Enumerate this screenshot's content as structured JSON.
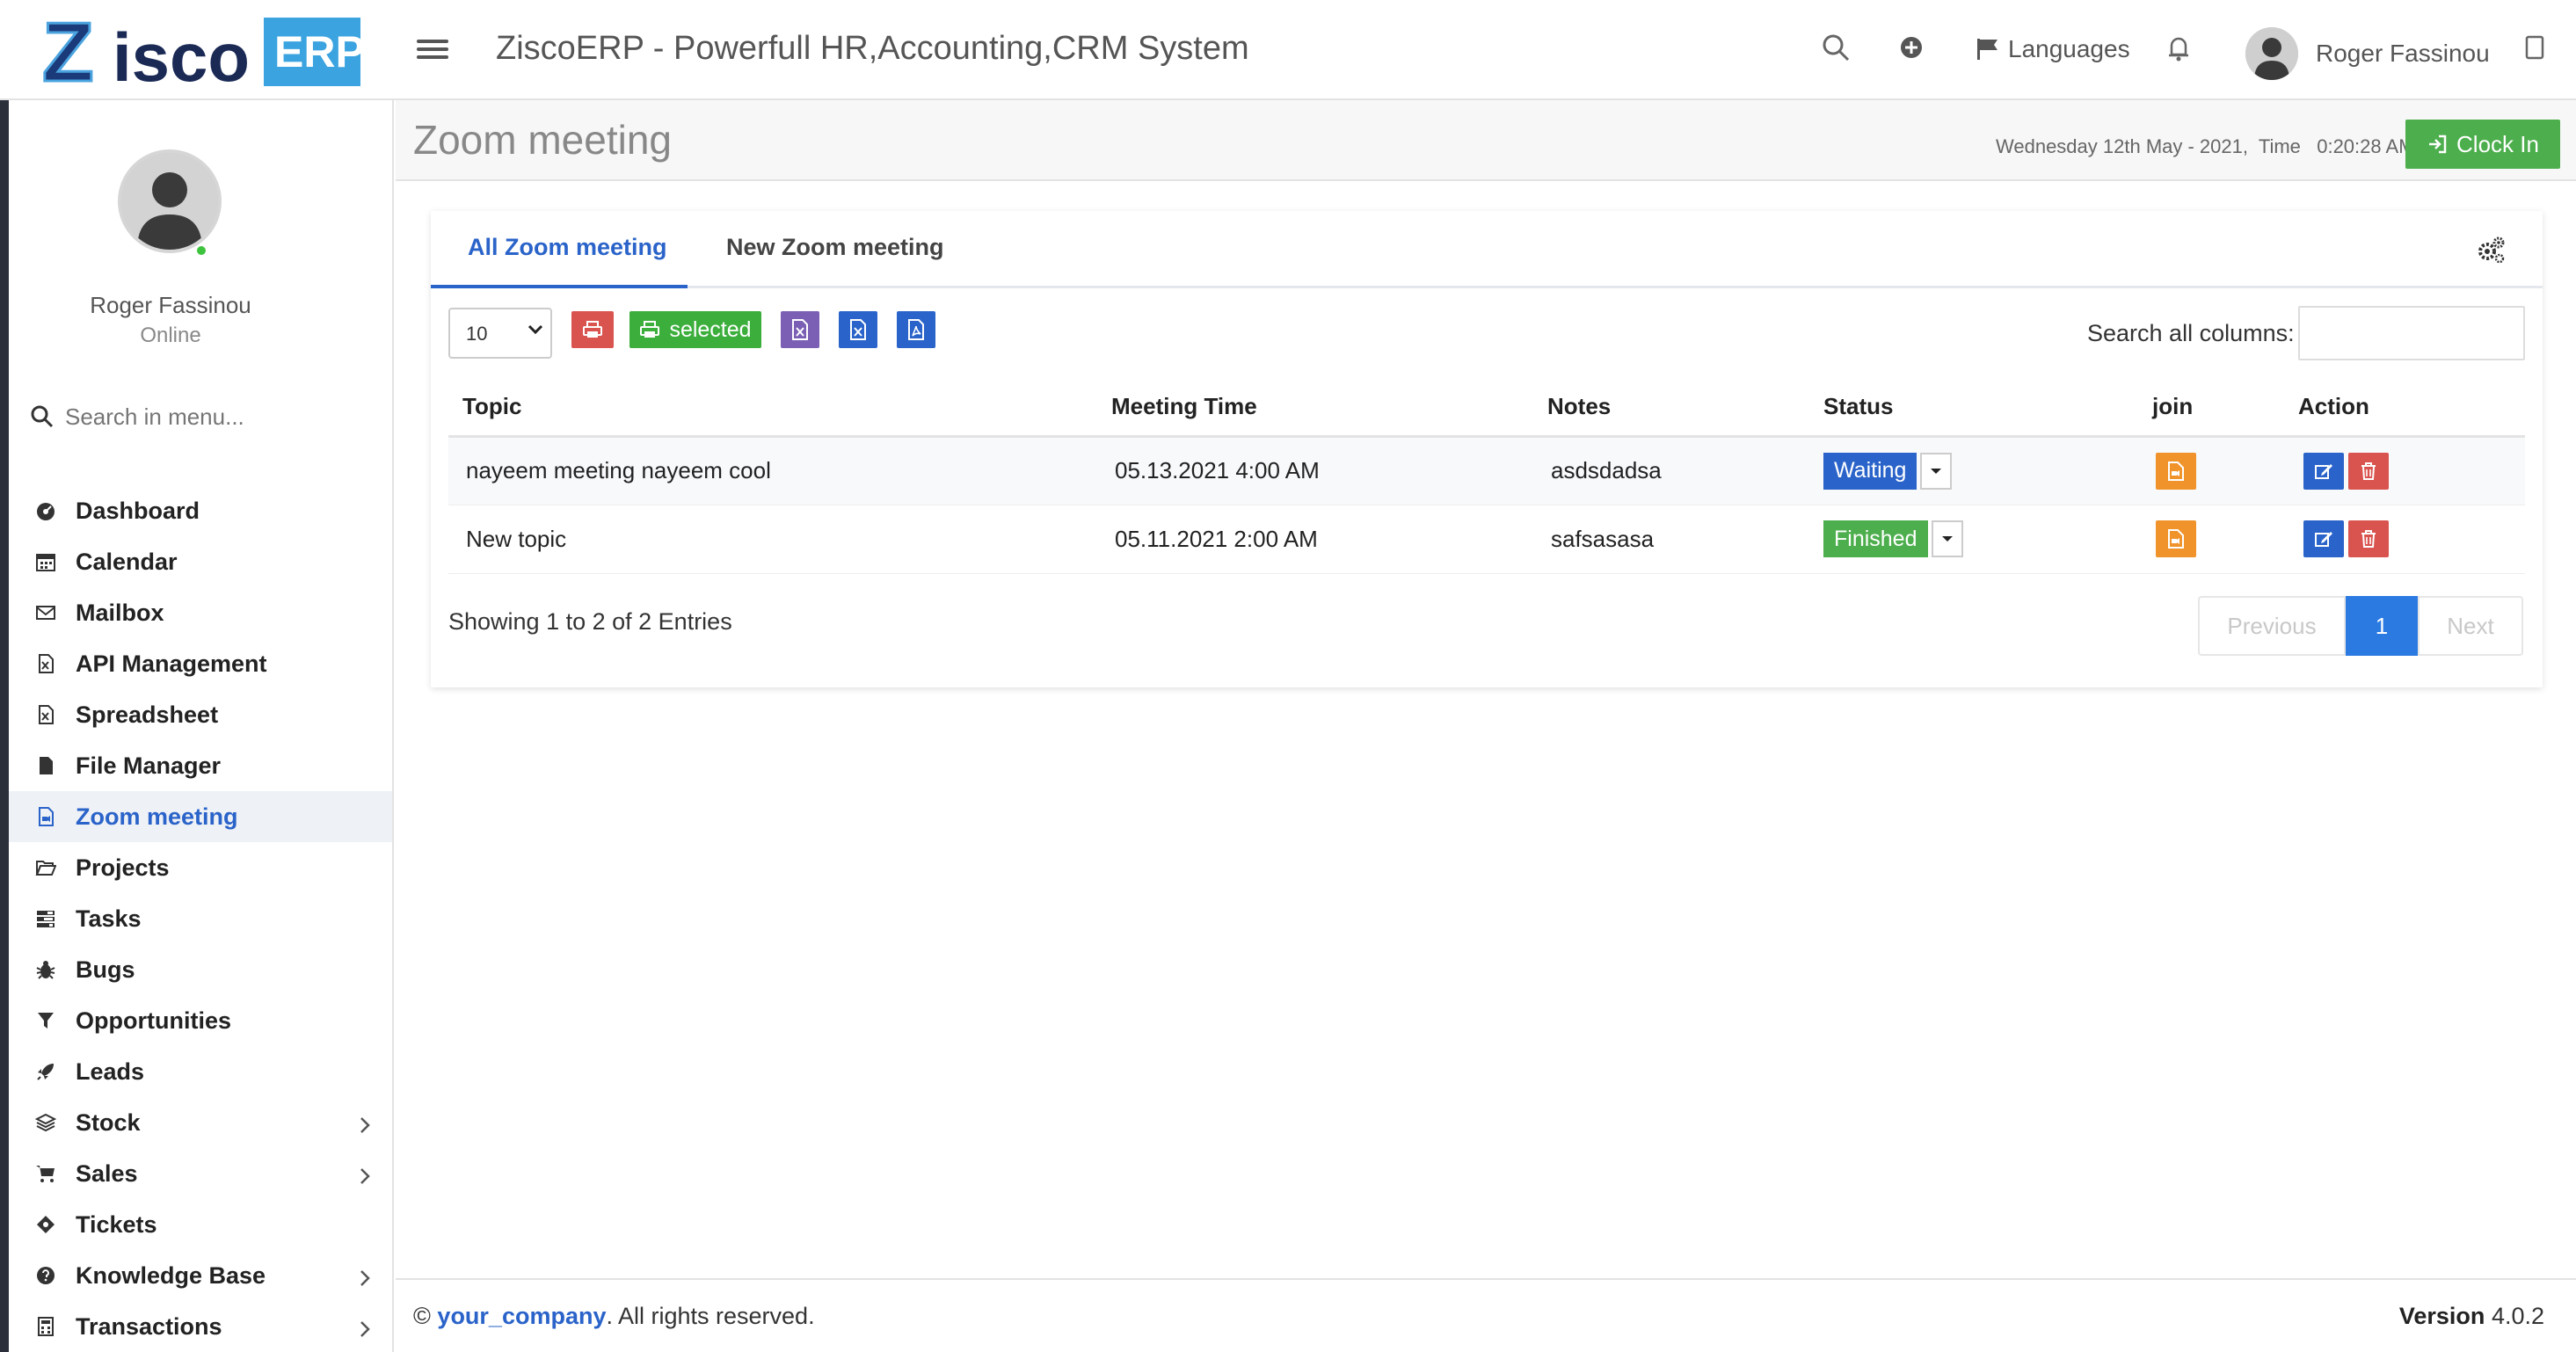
{
  "brand": {
    "logo_text": "Zisco",
    "logo_badge": "ERP"
  },
  "header": {
    "app_title": "ZiscoERP - Powerfull HR,Accounting,CRM System",
    "languages_label": "Languages",
    "user_name": "Roger Fassinou"
  },
  "sidebar": {
    "profile_name": "Roger Fassinou",
    "profile_status": "Online",
    "search_placeholder": "Search in menu...",
    "items": [
      {
        "label": "Dashboard",
        "icon": "dashboard-icon",
        "has_submenu": false
      },
      {
        "label": "Calendar",
        "icon": "calendar-icon",
        "has_submenu": false
      },
      {
        "label": "Mailbox",
        "icon": "envelope-icon",
        "has_submenu": false
      },
      {
        "label": "API Management",
        "icon": "excel-file-icon",
        "has_submenu": false
      },
      {
        "label": "Spreadsheet",
        "icon": "excel-file-icon",
        "has_submenu": false
      },
      {
        "label": "File Manager",
        "icon": "file-icon",
        "has_submenu": false
      },
      {
        "label": "Zoom meeting",
        "icon": "video-file-icon",
        "has_submenu": false,
        "active": true
      },
      {
        "label": "Projects",
        "icon": "folder-open-icon",
        "has_submenu": false
      },
      {
        "label": "Tasks",
        "icon": "tasks-icon",
        "has_submenu": false
      },
      {
        "label": "Bugs",
        "icon": "bug-icon",
        "has_submenu": false
      },
      {
        "label": "Opportunities",
        "icon": "filter-icon",
        "has_submenu": false
      },
      {
        "label": "Leads",
        "icon": "rocket-icon",
        "has_submenu": false
      },
      {
        "label": "Stock",
        "icon": "layers-icon",
        "has_submenu": true
      },
      {
        "label": "Sales",
        "icon": "cart-icon",
        "has_submenu": true
      },
      {
        "label": "Tickets",
        "icon": "ticket-icon",
        "has_submenu": false
      },
      {
        "label": "Knowledge Base",
        "icon": "question-circle-icon",
        "has_submenu": true
      },
      {
        "label": "Transactions",
        "icon": "calculator-icon",
        "has_submenu": true
      }
    ]
  },
  "content": {
    "page_title": "Zoom meeting",
    "datetime": "Wednesday 12th May - 2021,  Time   0:20:28 AM",
    "clock_in_label": "Clock In"
  },
  "tabs": {
    "all": "All Zoom meeting",
    "new": "New Zoom meeting"
  },
  "toolbar": {
    "page_size": "10",
    "page_size_options": [
      "10"
    ],
    "selected_label": "selected",
    "search_label": "Search all columns:",
    "search_value": ""
  },
  "table": {
    "columns": [
      "Topic",
      "Meeting Time",
      "Notes",
      "Status",
      "join",
      "Action"
    ],
    "rows": [
      {
        "topic": "nayeem meeting nayeem cool",
        "meeting_time": "05.13.2021 4:00 AM",
        "notes": "asdsdadsa",
        "status": "Waiting",
        "status_color": "#2a63c9"
      },
      {
        "topic": "New topic",
        "meeting_time": "05.11.2021 2:00 AM",
        "notes": "safsasasa",
        "status": "Finished",
        "status_color": "#4cae4c"
      }
    ],
    "info": "Showing 1 to 2 of 2 Entries",
    "pagination": {
      "previous": "Previous",
      "current": "1",
      "next": "Next"
    }
  },
  "footer": {
    "copyright_symbol": "©",
    "company": "your_company",
    "rights": ". All rights reserved.",
    "version_label": "Version",
    "version_value": "4.0.2"
  },
  "colors": {
    "accent": "#2a63c9",
    "success": "#4cae4c",
    "danger": "#d9534f",
    "warning": "#f0932b",
    "purple": "#7a5fb4"
  }
}
